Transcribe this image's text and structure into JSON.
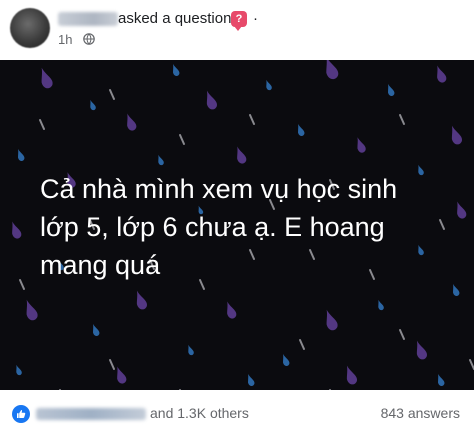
{
  "post": {
    "author_name": "Nguyen Van",
    "action": "asked a question",
    "badge_glyph": "?",
    "separator": "·",
    "time": "1h",
    "privacy_icon": "globe-icon",
    "body_text": "Cả nhà mình xem vụ học sinh\nlớp 5, lớp 6 chưa ạ. E hoang\nmang quá",
    "background": "dark-rain",
    "colors": {
      "badge": "#e74a6a",
      "like": "#1877f2",
      "image_bg": "#0b0b0f",
      "drop_purple": "#5b3c8f",
      "drop_blue": "#2f6fb3"
    }
  },
  "footer": {
    "reaction_icon": "like-icon",
    "liker_name": "Huỳnh Kim Dung",
    "reactions_text": "and 1.3K others",
    "answers_text": "843 answers"
  }
}
